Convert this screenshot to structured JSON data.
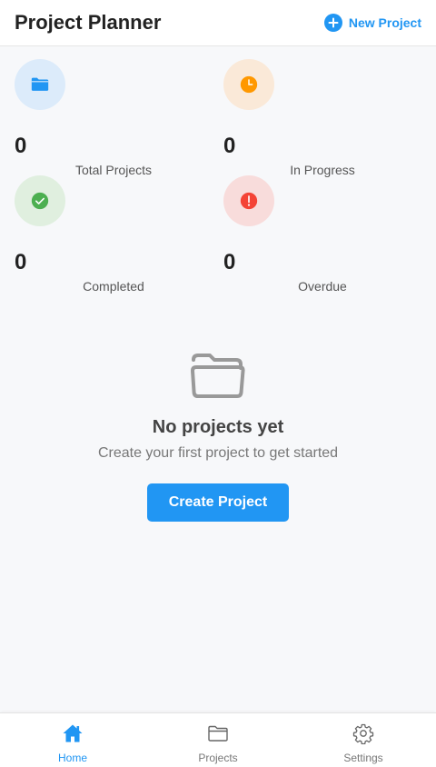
{
  "header": {
    "title": "Project Planner",
    "new_project_label": "New Project",
    "plus_symbol": "+"
  },
  "stats": [
    {
      "value": "0",
      "label": "Total Projects",
      "icon": "folder-icon",
      "color": "#2196f3",
      "bg": "#dcebfa"
    },
    {
      "value": "0",
      "label": "In Progress",
      "icon": "clock-icon",
      "color": "#ff9800",
      "bg": "#fae9d8"
    },
    {
      "value": "0",
      "label": "Completed",
      "icon": "check-circle-icon",
      "color": "#4caf50",
      "bg": "#e0efdf"
    },
    {
      "value": "0",
      "label": "Overdue",
      "icon": "alert-circle-icon",
      "color": "#f44336",
      "bg": "#f8dcdb"
    }
  ],
  "empty_state": {
    "icon": "folder-open-icon",
    "title": "No projects yet",
    "subtitle": "Create your first project to get started",
    "button_label": "Create Project"
  },
  "bottom_nav": [
    {
      "label": "Home",
      "icon": "home-icon",
      "active": true
    },
    {
      "label": "Projects",
      "icon": "folder-icon",
      "active": false
    },
    {
      "label": "Settings",
      "icon": "gear-icon",
      "active": false
    }
  ],
  "colors": {
    "accent": "#2196f3",
    "background": "#f7f8fa"
  }
}
